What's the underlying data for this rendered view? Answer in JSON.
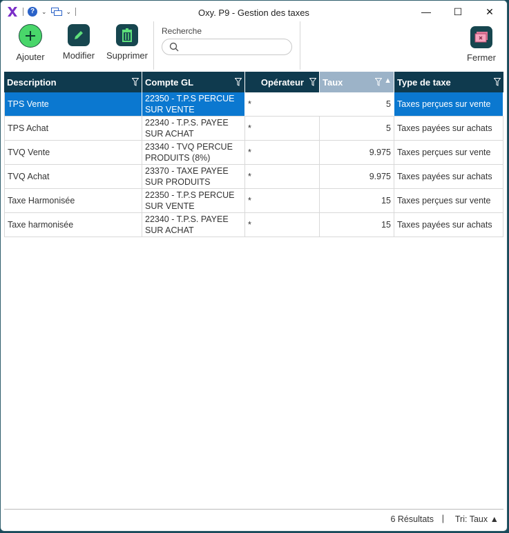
{
  "window": {
    "title": "Oxy. P9 - Gestion des taxes"
  },
  "toolbar": {
    "add_label": "Ajouter",
    "edit_label": "Modifier",
    "delete_label": "Supprimer",
    "close_label": "Fermer",
    "search_label": "Recherche",
    "search_value": ""
  },
  "grid": {
    "columns": [
      "Description",
      "Compte GL",
      "Opérateur",
      "Taux",
      "Type de taxe"
    ],
    "rows": [
      {
        "description": "TPS Vente",
        "compte_l1": "22350 - T.P.S PERCUE",
        "compte_l2": "SUR VENTE",
        "operateur": "*",
        "taux": "5",
        "type": "Taxes perçues sur vente"
      },
      {
        "description": "TPS Achat",
        "compte_l1": "22340 - T.P.S. PAYEE",
        "compte_l2": "SUR ACHAT",
        "operateur": "*",
        "taux": "5",
        "type": "Taxes payées sur achats"
      },
      {
        "description": "TVQ Vente",
        "compte_l1": "23340 - TVQ PERCUE",
        "compte_l2": "PRODUITS (8%)",
        "operateur": "*",
        "taux": "9.975",
        "type": "Taxes perçues sur vente"
      },
      {
        "description": "TVQ Achat",
        "compte_l1": "23370 - TAXE PAYEE",
        "compte_l2": "SUR PRODUITS",
        "operateur": "*",
        "taux": "9.975",
        "type": "Taxes payées sur achats"
      },
      {
        "description": "Taxe Harmonisée",
        "compte_l1": "22350 - T.P.S PERCUE",
        "compte_l2": "SUR VENTE",
        "operateur": "*",
        "taux": "15",
        "type": "Taxes perçues sur vente"
      },
      {
        "description": "Taxe harmonisée",
        "compte_l1": "22340 - T.P.S. PAYEE",
        "compte_l2": "SUR ACHAT",
        "operateur": "*",
        "taux": "15",
        "type": "Taxes payées sur achats"
      }
    ]
  },
  "footer": {
    "results": "6 Résultats",
    "separator": "|",
    "sort_label": "Tri: Taux",
    "sort_arrow": "▲"
  },
  "colors": {
    "header": "#0f3a4e",
    "selected_row": "#0b78d0",
    "sorted_header": "#9cb3c8",
    "accent_icon": "#17464f"
  }
}
